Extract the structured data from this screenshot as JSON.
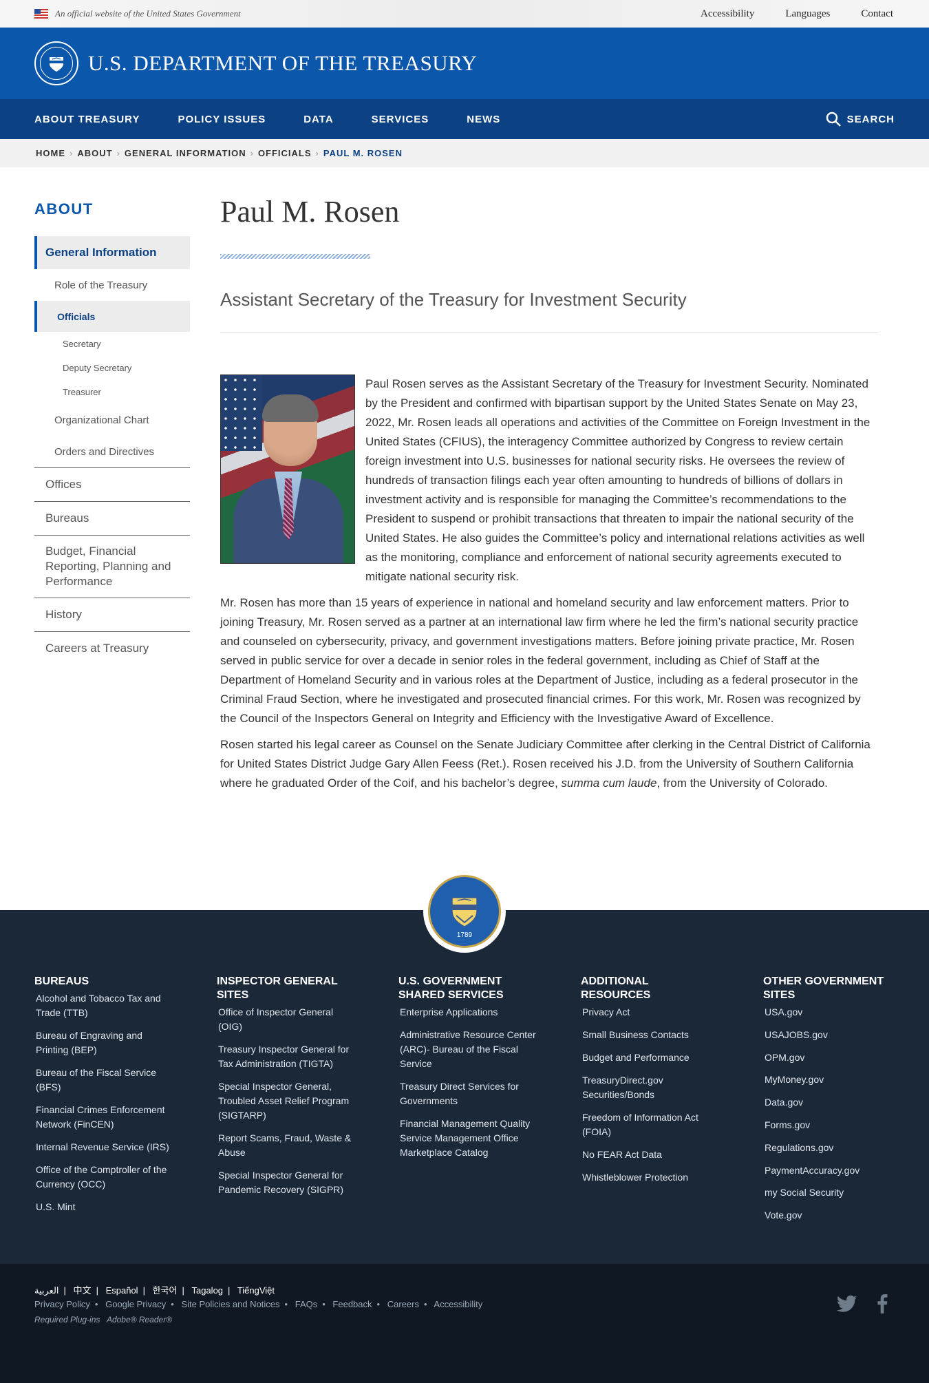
{
  "gov_banner": {
    "text": "An official website of the United States Government",
    "links": [
      "Accessibility",
      "Languages",
      "Contact"
    ]
  },
  "header": {
    "title": "U.S. DEPARTMENT OF THE TREASURY"
  },
  "nav": {
    "items": [
      "ABOUT TREASURY",
      "POLICY ISSUES",
      "DATA",
      "SERVICES",
      "NEWS"
    ],
    "search_label": "SEARCH"
  },
  "breadcrumb": [
    "HOME",
    "ABOUT",
    "GENERAL INFORMATION",
    "OFFICIALS",
    "PAUL M. ROSEN"
  ],
  "sidebar": {
    "title": "ABOUT",
    "general_information": "General Information",
    "role": "Role of the Treasury",
    "officials": "Officials",
    "officials_sub": [
      "Secretary",
      "Deputy Secretary",
      "Treasurer"
    ],
    "org_chart": "Organizational Chart",
    "orders": "Orders and Directives",
    "main": [
      "Offices",
      "Bureaus",
      "Budget, Financial Reporting, Planning and Performance",
      "History",
      "Careers at Treasury"
    ]
  },
  "main": {
    "title": "Paul M. Rosen",
    "subtitle": "Assistant Secretary of the Treasury for Investment Security",
    "bio_p1": "Paul Rosen serves as the Assistant Secretary of the Treasury for Investment Security.  Nominated by the President and confirmed with bipartisan support by the United States Senate on May 23, 2022, Mr. Rosen leads all operations and activities of the Committee on Foreign Investment in the United States (CFIUS), the interagency Committee authorized by Congress to review certain foreign investment into U.S. businesses for national security risks.  He oversees the review of hundreds of transaction filings each year often amounting to hundreds of billions of dollars in investment activity and is responsible for managing the Committee’s recommendations to the President to suspend or prohibit transactions that threaten to impair the national security of the United States.  He also guides the Committee’s policy and international relations activities as well as the monitoring, compliance and enforcement of national security agreements executed to mitigate national security risk.",
    "bio_p2": "Mr. Rosen has more than 15 years of experience in national and homeland security and law enforcement matters.  Prior to joining Treasury, Mr. Rosen served as a partner at an international law firm where he led the firm’s national security practice and counseled on cybersecurity, privacy, and government investigations matters.  Before joining private practice, Mr. Rosen served in public service for over a decade in senior roles in the federal government, including as Chief of Staff at the Department of Homeland Security and in various roles at the Department of Justice, including as a federal prosecutor in the Criminal Fraud Section, where he investigated and prosecuted financial crimes. For this work, Mr. Rosen was recognized by the Council of the Inspectors General on Integrity and Efficiency with the Investigative Award of Excellence.",
    "bio_p3_a": "Rosen started his legal career as Counsel on the Senate Judiciary Committee after clerking in the Central District of California for United States District Judge Gary Allen Feess (Ret.). Rosen received his J.D. from the University of Southern California where he graduated Order of the Coif, and his bachelor’s degree, ",
    "bio_p3_em": "summa cum laude",
    "bio_p3_b": ", from the University of Colorado."
  },
  "footer": {
    "seal_year": "1789",
    "columns": [
      {
        "heading": "BUREAUS",
        "links": [
          "Alcohol and Tobacco Tax and Trade (TTB)",
          "Bureau of Engraving and Printing (BEP)",
          "Bureau of the Fiscal Service (BFS)",
          "Financial Crimes Enforcement Network (FinCEN)",
          "Internal Revenue Service (IRS)",
          "Office of the Comptroller of the Currency (OCC)",
          "U.S. Mint"
        ]
      },
      {
        "heading": "INSPECTOR GENERAL SITES",
        "links": [
          "Office of Inspector General (OIG)",
          "Treasury Inspector General for Tax Administration (TIGTA)",
          "Special Inspector General, Troubled Asset Relief Program (SIGTARP)",
          "Report Scams, Fraud, Waste & Abuse",
          "Special Inspector General for Pandemic Recovery (SIGPR)"
        ]
      },
      {
        "heading": "U.S. GOVERNMENT SHARED SERVICES",
        "links": [
          "Enterprise Applications",
          "Administrative Resource Center (ARC)- Bureau of the Fiscal Service",
          "Treasury Direct Services for Governments",
          "Financial Management Quality Service Management Office Marketplace Catalog"
        ]
      },
      {
        "heading": "ADDITIONAL RESOURCES",
        "links": [
          "Privacy Act",
          "Small Business Contacts",
          "Budget and Performance",
          "TreasuryDirect.gov Securities/Bonds",
          "Freedom of Information Act (FOIA)",
          "No FEAR Act Data",
          "Whistleblower Protection"
        ]
      },
      {
        "heading": "OTHER GOVERNMENT SITES",
        "links": [
          "USA.gov",
          "USAJOBS.gov",
          "OPM.gov",
          "MyMoney.gov",
          "Data.gov",
          "Forms.gov",
          "Regulations.gov",
          "PaymentAccuracy.gov",
          "my Social Security",
          "Vote.gov"
        ]
      }
    ],
    "languages": [
      "العربية",
      "中文",
      "Español",
      "한국어",
      "Tagalog",
      "TiếngViệt"
    ],
    "policy_links": [
      "Privacy Policy",
      "Google Privacy",
      "Site Policies and Notices",
      "FAQs",
      "Feedback",
      "Careers",
      "Accessibility"
    ],
    "plugins_label": "Required Plug-ins",
    "plugins_value": "Adobe® Reader®",
    "social_icons": [
      "twitter-icon",
      "facebook-icon"
    ]
  }
}
